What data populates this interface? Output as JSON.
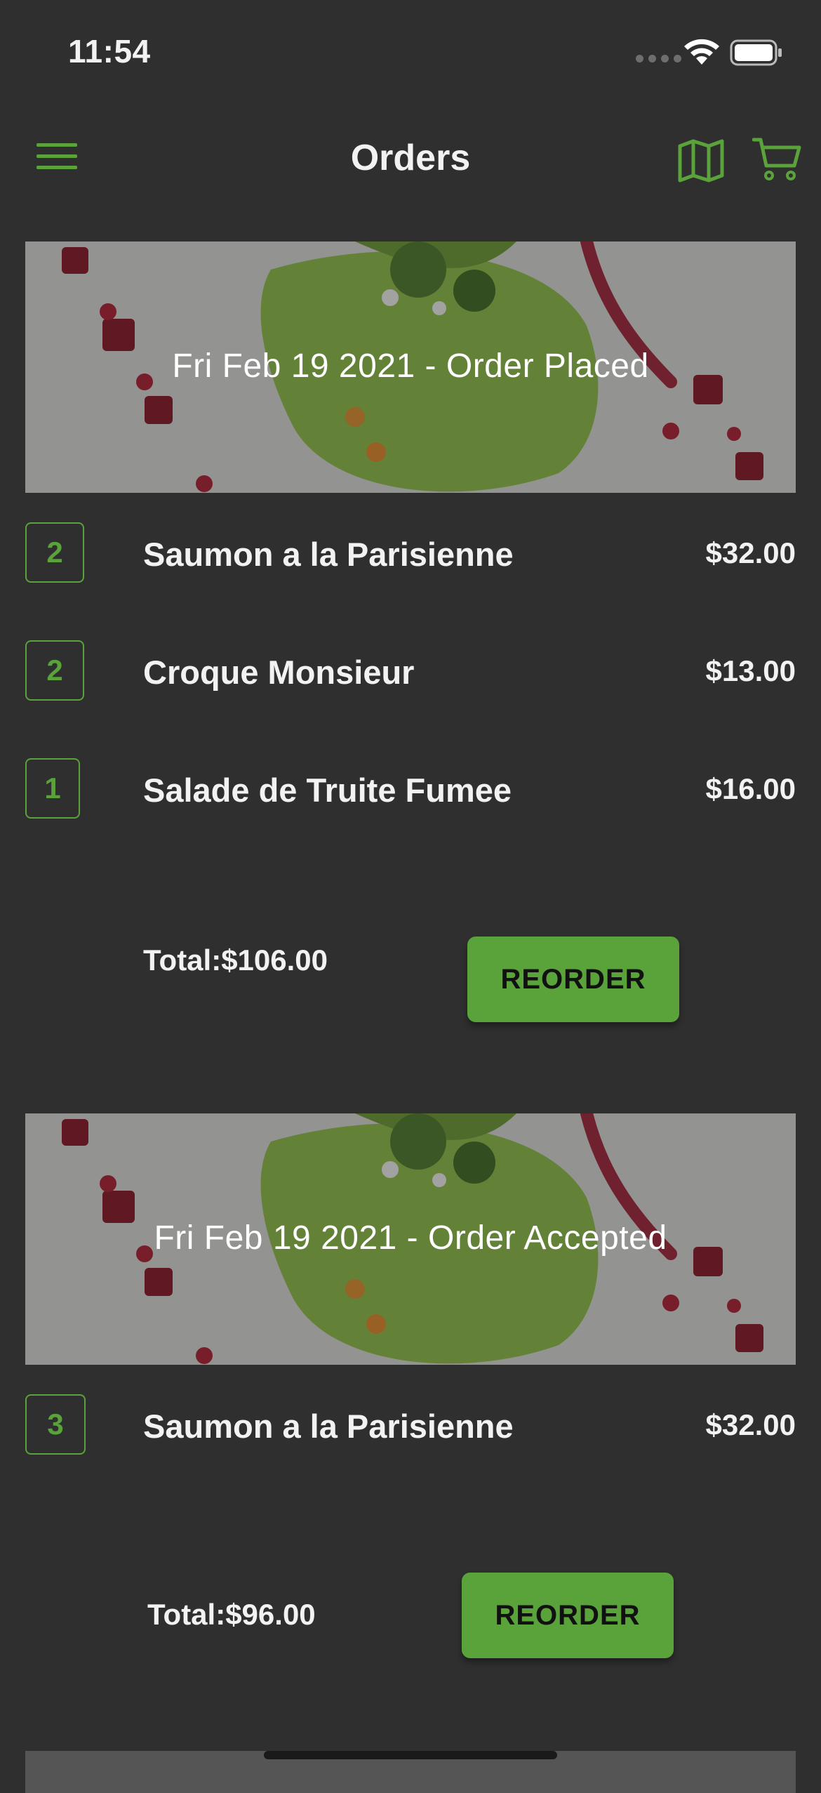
{
  "status_bar": {
    "time": "11:54"
  },
  "nav": {
    "title": "Orders",
    "icons": [
      "menu-icon",
      "map-icon",
      "cart-icon"
    ]
  },
  "colors": {
    "accent": "#5aa23a",
    "background": "#2f2f2f",
    "text": "#f2f2f2"
  },
  "orders": [
    {
      "banner_text": "Fri Feb 19 2021 - Order Placed",
      "items": [
        {
          "qty": "2",
          "name": "Saumon a la Parisienne",
          "price": "$32.00"
        },
        {
          "qty": "2",
          "name": "Croque Monsieur",
          "price": "$13.00"
        },
        {
          "qty": "1",
          "name": "Salade de Truite Fumee",
          "price": "$16.00"
        }
      ],
      "total": "Total:$106.00",
      "reorder_label": "REORDER"
    },
    {
      "banner_text": "Fri Feb 19 2021 - Order Accepted",
      "items": [
        {
          "qty": "3",
          "name": "Saumon a la Parisienne",
          "price": "$32.00"
        }
      ],
      "total": "Total:$96.00",
      "reorder_label": "REORDER"
    }
  ]
}
